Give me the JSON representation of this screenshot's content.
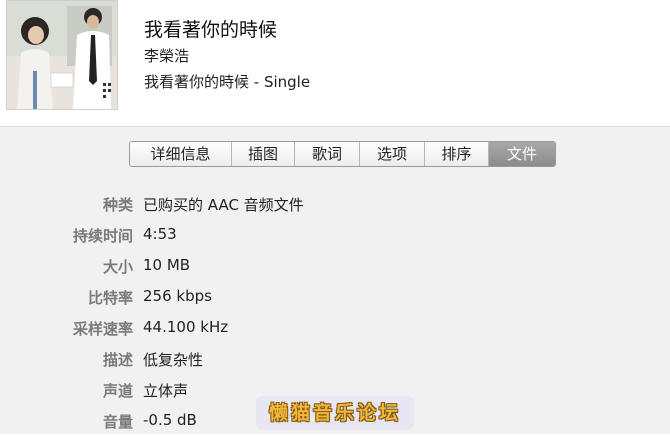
{
  "track": {
    "title": "我看著你的時候",
    "artist": "李榮浩",
    "album": "我看著你的時候 - Single"
  },
  "tabs": [
    {
      "label": "详细信息",
      "active": false
    },
    {
      "label": "插图",
      "active": false
    },
    {
      "label": "歌词",
      "active": false
    },
    {
      "label": "选项",
      "active": false
    },
    {
      "label": "排序",
      "active": false
    },
    {
      "label": "文件",
      "active": true
    }
  ],
  "file_info": {
    "kind_label": "种类",
    "kind_value": "已购买的 AAC 音频文件",
    "duration_label": "持续时间",
    "duration_value": "4:53",
    "size_label": "大小",
    "size_value": "10 MB",
    "bitrate_label": "比特率",
    "bitrate_value": "256 kbps",
    "samplerate_label": "采样速率",
    "samplerate_value": "44.100 kHz",
    "description_label": "描述",
    "description_value": "低复杂性",
    "channels_label": "声道",
    "channels_value": "立体声",
    "volume_label": "音量",
    "volume_value": "-0.5 dB"
  },
  "watermark": {
    "text": "懒猫音乐论坛"
  },
  "colors": {
    "active_tab": "#9a9a9a",
    "label_gray": "#7a7a7a",
    "panel_bg": "#f1f1f1",
    "watermark_text": "#f3b53a"
  }
}
